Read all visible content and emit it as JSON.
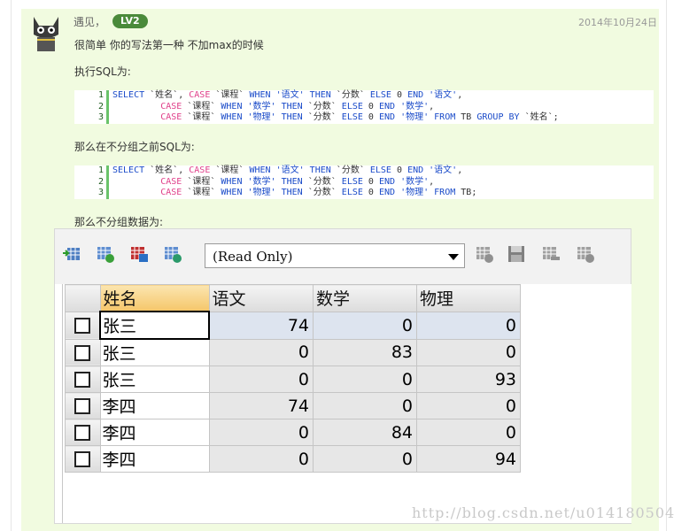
{
  "comment": {
    "username": "遇见，",
    "level": "LV2",
    "date": "2014年10月24日",
    "line1": "很简单 你的写法第一种  不加max的时候",
    "label_sql": "执行SQL为:",
    "label_before_group": "那么在不分组之前SQL为:",
    "label_data": "那么不分组数据为:",
    "watermark": "http://blog.csdn.net/u014180504"
  },
  "code1": [
    {
      "n": "1",
      "t": "SELECT `姓名`, CASE `课程` WHEN '语文' THEN `分数` ELSE 0 END '语文',"
    },
    {
      "n": "2",
      "t": "         CASE `课程` WHEN '数学' THEN `分数` ELSE 0 END '数学',"
    },
    {
      "n": "3",
      "t": "         CASE `课程` WHEN '物理' THEN `分数` ELSE 0 END '物理' FROM TB GROUP BY `姓名`;"
    }
  ],
  "code2": [
    {
      "n": "1",
      "t": "SELECT `姓名`, CASE `课程` WHEN '语文' THEN `分数` ELSE 0 END '语文',"
    },
    {
      "n": "2",
      "t": "         CASE `课程` WHEN '数学' THEN `分数` ELSE 0 END '数学',"
    },
    {
      "n": "3",
      "t": "         CASE `课程` WHEN '物理' THEN `分数` ELSE 0 END '物理' FROM TB;"
    }
  ],
  "tool": {
    "combo_value": "(Read Only)",
    "icons": [
      "grid-export-icon",
      "grid-add-icon",
      "grid-save-icon",
      "grid-refresh-icon",
      "grid-insert-icon",
      "disk-save-icon",
      "grid-delete-icon",
      "grid-cancel-icon"
    ]
  },
  "grid": {
    "headers": [
      "姓名",
      "语文",
      "数学",
      "物理"
    ],
    "rows": [
      [
        "张三",
        "74",
        "0",
        "0"
      ],
      [
        "张三",
        "0",
        "83",
        "0"
      ],
      [
        "张三",
        "0",
        "0",
        "93"
      ],
      [
        "李四",
        "74",
        "0",
        "0"
      ],
      [
        "李四",
        "0",
        "84",
        "0"
      ],
      [
        "李四",
        "0",
        "0",
        "94"
      ]
    ]
  }
}
